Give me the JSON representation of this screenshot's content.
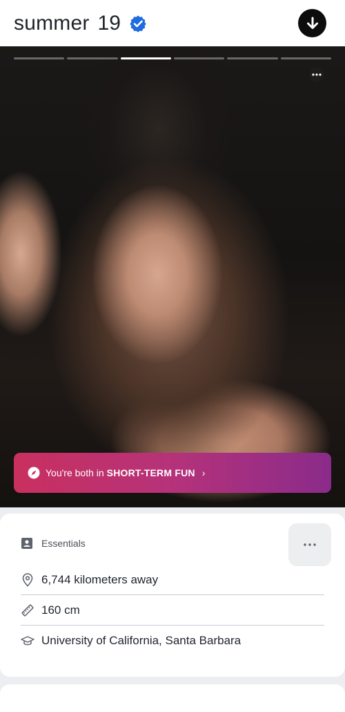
{
  "profile": {
    "name": "summer",
    "age": "19"
  },
  "photo": {
    "count": 6,
    "active_index": 2,
    "intent_prefix": "You're both in",
    "intent_label": "SHORT-TERM FUN",
    "intent_chevron": "›"
  },
  "essentials": {
    "title": "Essentials",
    "items": [
      {
        "icon": "location-pin-icon",
        "text": "6,744 kilometers away"
      },
      {
        "icon": "ruler-icon",
        "text": "160 cm"
      },
      {
        "icon": "graduation-cap-icon",
        "text": "University of California, Santa Barbara"
      }
    ]
  },
  "colors": {
    "verified": "#1f6ce0",
    "intent_gradient_start": "#c9305f",
    "intent_gradient_end": "#8a2b8a"
  }
}
